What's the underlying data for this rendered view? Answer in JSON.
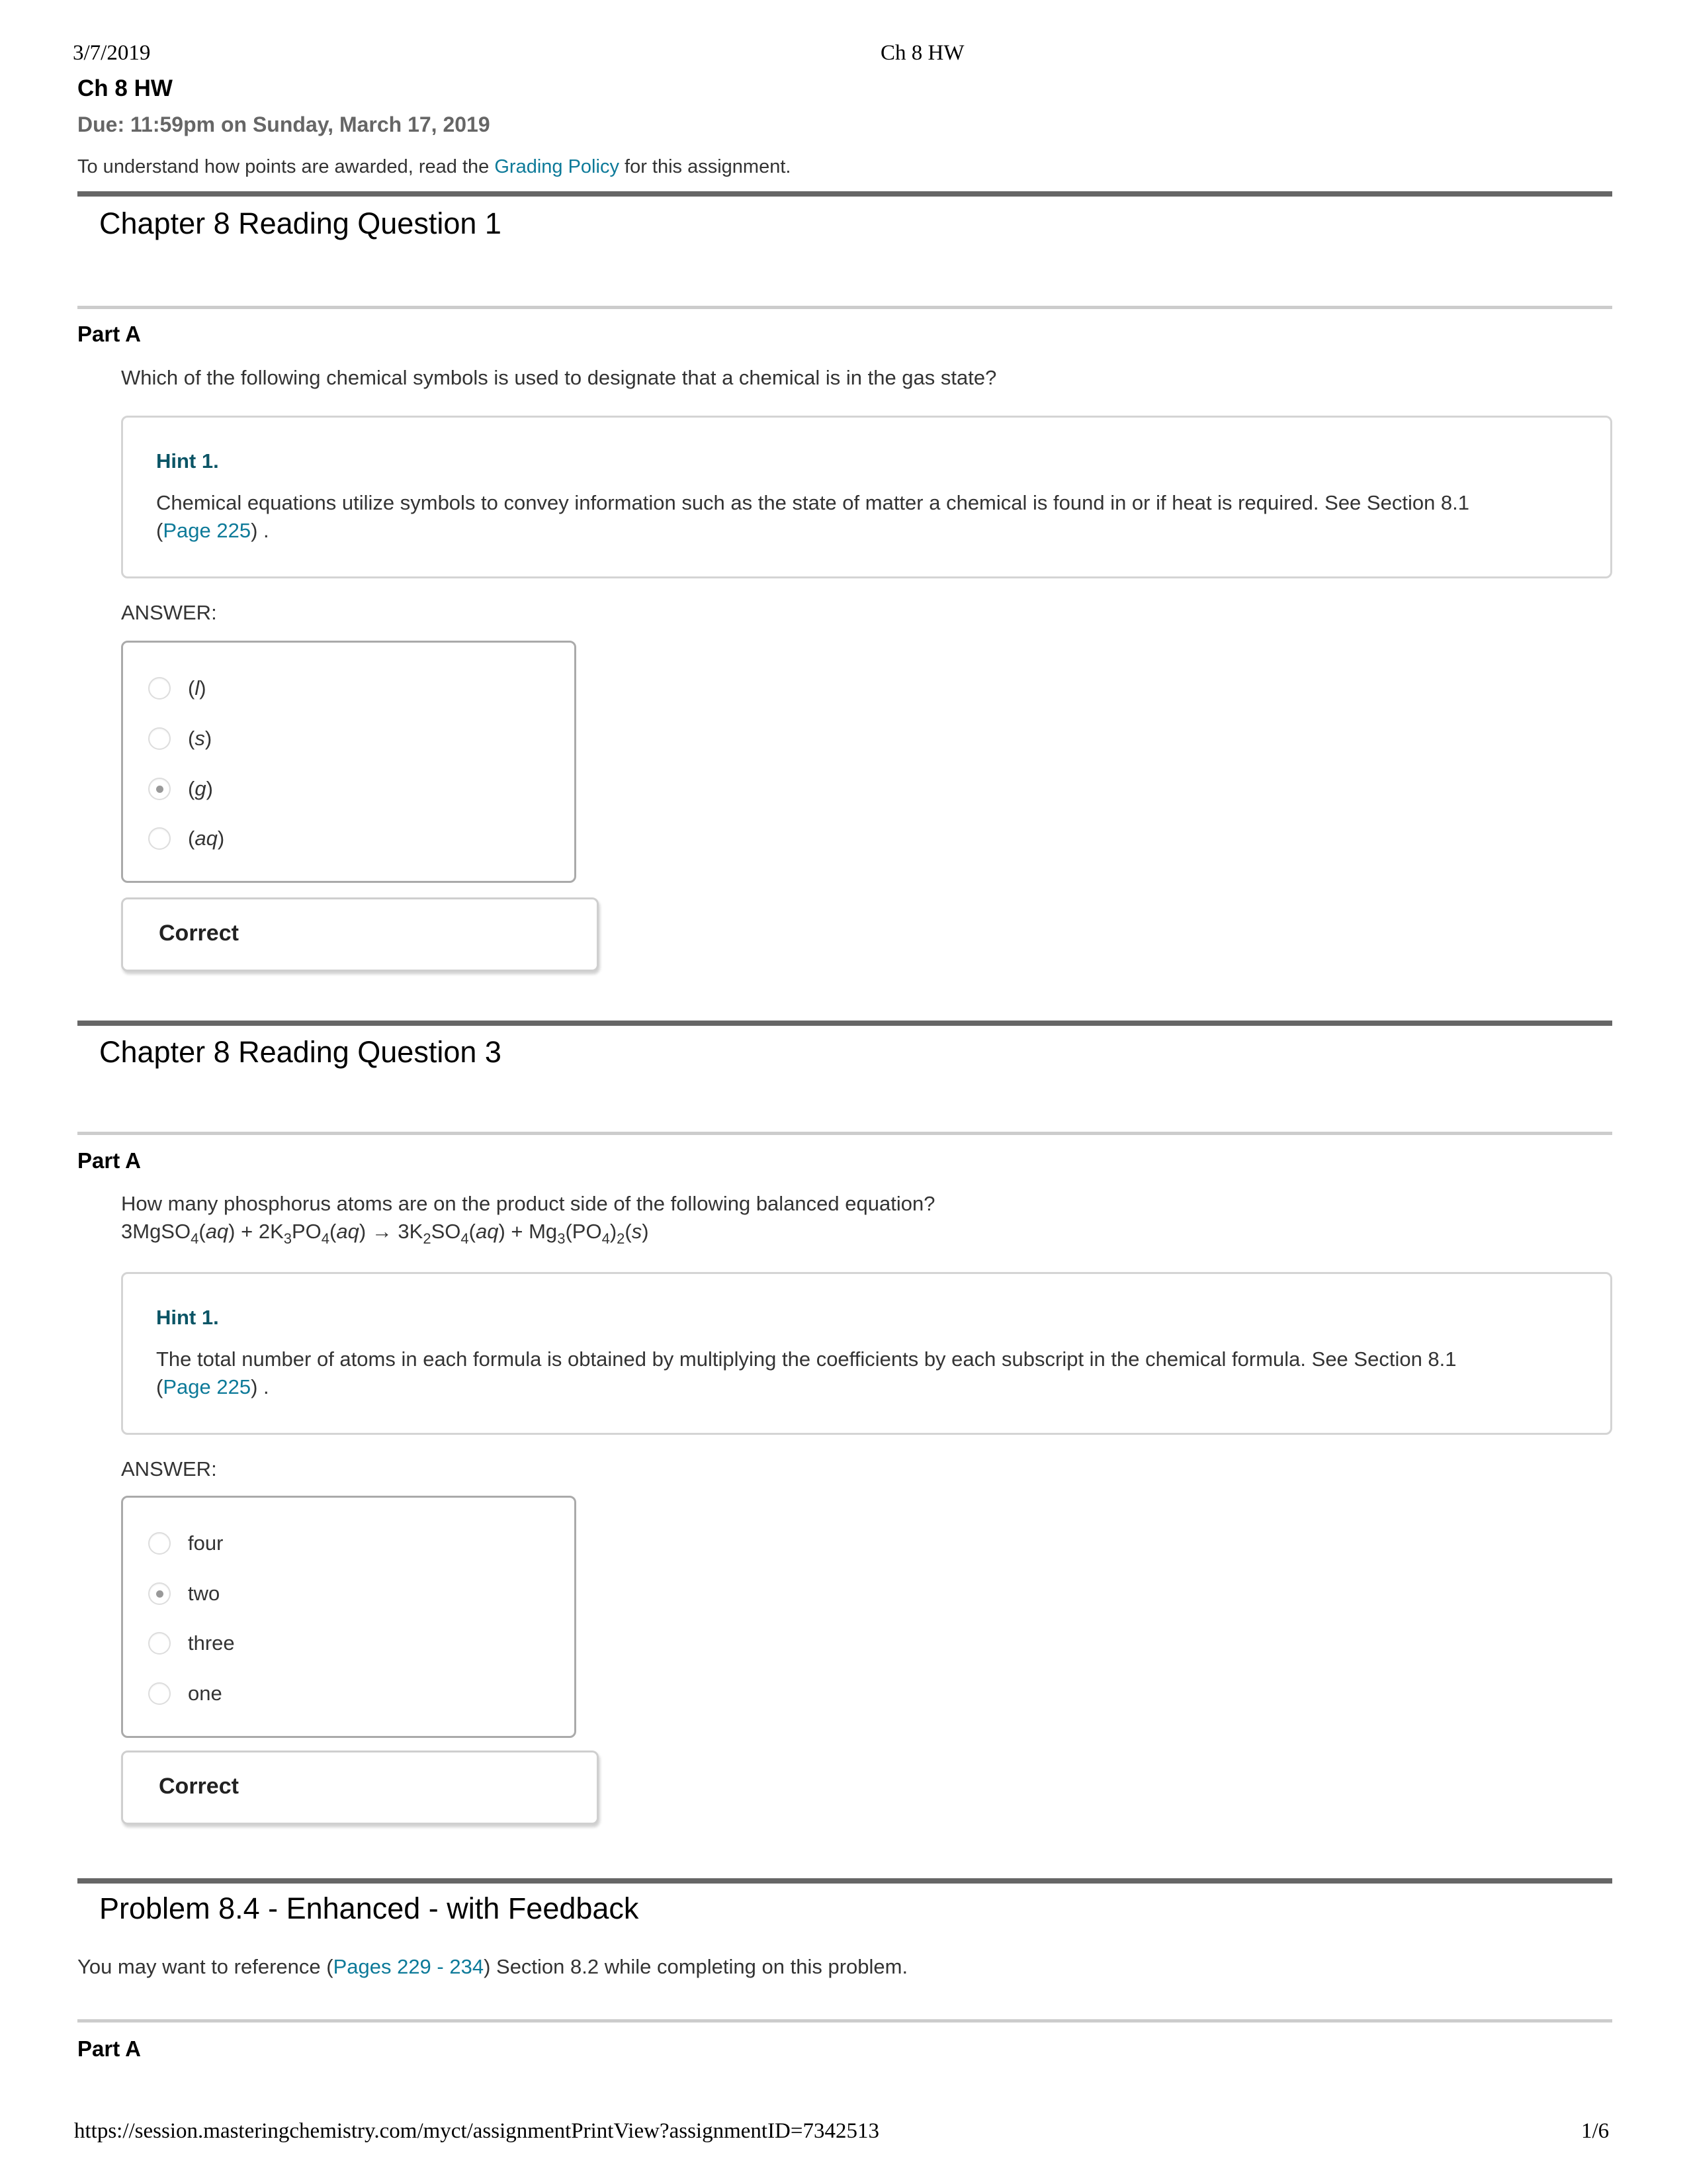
{
  "print_header": {
    "date": "3/7/2019",
    "title": "Ch 8 HW"
  },
  "print_footer": {
    "url": "https://session.masteringchemistry.com/myct/assignmentPrintView?assignmentID=7342513",
    "page": "1/6"
  },
  "assignment": {
    "title": "Ch 8 HW",
    "due": "Due: 11:59pm on Sunday, March 17, 2019",
    "policy_prefix": "To understand how points are awarded, read the ",
    "policy_link": "Grading Policy",
    "policy_suffix": " for this assignment."
  },
  "colors": {
    "link": "#0d7a99",
    "hint_title": "#0b5566",
    "rule_dark": "#666666",
    "rule_light": "#cccccc",
    "due_text": "#666666"
  },
  "questions": [
    {
      "title": "Chapter 8 Reading Question 1",
      "part": "Part A",
      "prompt": "Which of the following chemical symbols is used to designate that a chemical is in the gas state?",
      "hint": {
        "title": "Hint 1.",
        "text": "Chemical equations utilize symbols to convey information such as the state of matter a chemical is found in or if heat is required. See Section 8.1 ",
        "link_open": "(",
        "link": "Page 225",
        "link_close": ") ."
      },
      "answer_label": "ANSWER:",
      "options": [
        {
          "open": "(",
          "symbol": "l",
          "close": ")",
          "selected": false
        },
        {
          "open": "(",
          "symbol": "s",
          "close": ")",
          "selected": false
        },
        {
          "open": "(",
          "symbol": "g",
          "close": ")",
          "selected": true
        },
        {
          "open": "(",
          "symbol": "aq",
          "close": ")",
          "selected": false
        }
      ],
      "feedback": "Correct"
    },
    {
      "title": "Chapter 8 Reading Question 3",
      "part": "Part A",
      "prompt": "How many phosphorus atoms are on the product side of the following balanced equation?",
      "equation": {
        "t1": "3MgSO",
        "s1": "4",
        "st1": "aq",
        "t2": " + 2K",
        "s2": "3",
        "t3": "PO",
        "s3": "4",
        "st2": "aq",
        "t4": " → 3K",
        "s4": "2",
        "t5": "SO",
        "s5": "4",
        "st3": "aq",
        "t6": " + Mg",
        "s6": "3",
        "t7": "(PO",
        "s7": "4",
        "t8": ")",
        "s8": "2",
        "st4": "s"
      },
      "hint": {
        "title": "Hint 1.",
        "text": "The total number of atoms in each formula is obtained by multiplying the coefficients by each subscript in the chemical formula. See Section 8.1 ",
        "link_open": "(",
        "link": "Page 225",
        "link_close": ") ."
      },
      "answer_label": "ANSWER:",
      "options": [
        {
          "label": "four",
          "selected": false
        },
        {
          "label": "two",
          "selected": true
        },
        {
          "label": "three",
          "selected": false
        },
        {
          "label": "one",
          "selected": false
        }
      ],
      "feedback": "Correct"
    },
    {
      "title": "Problem 8.4 - Enhanced - with Feedback",
      "intro_prefix": "You may want to reference (",
      "intro_link": "Pages 229 - 234",
      "intro_suffix": ") Section 8.2 while completing on this problem.",
      "part": "Part A"
    }
  ]
}
